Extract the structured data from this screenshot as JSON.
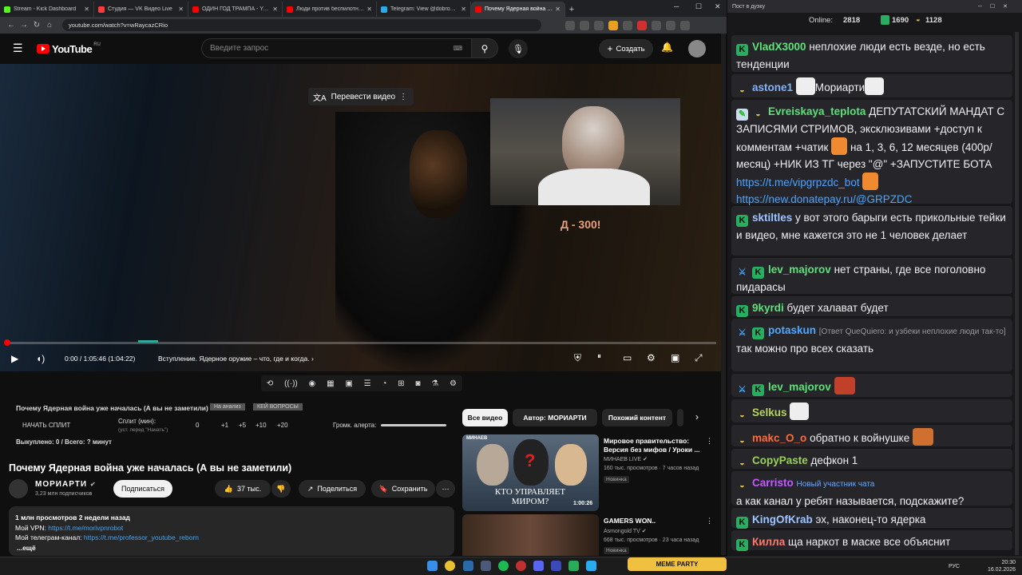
{
  "browser": {
    "tabs": [
      {
        "title": "Stream - Kick Dashboard",
        "color": "#53fc18"
      },
      {
        "title": "Студия — VK Видео Live",
        "color": "#ff3a3a"
      },
      {
        "title": "ОДИН ГОД ТРАМПА - YouTube",
        "color": "#ff0000"
      },
      {
        "title": "Люди против беспилотник: сек",
        "color": "#ff0000"
      },
      {
        "title": "Telegram: View @dobro_2ch",
        "color": "#2aabee"
      },
      {
        "title": "Почему Ядерная война уже н",
        "color": "#ff0000"
      }
    ],
    "url": "youtube.com/watch?v=wRaycazCRio"
  },
  "youtube": {
    "logo_text": "YouTube",
    "logo_region": "RU",
    "search_placeholder": "Введите запрос",
    "create_label": "Создать"
  },
  "video": {
    "translate_label": "Перевести видео",
    "overlay_caption": "Д - 300!",
    "time": "0:00 / 1:05:46 (1:04:22)",
    "chapter": "Вступление. Ядерное оружие – что, где и когда.",
    "progress": 0.0
  },
  "split_panel": {
    "title": "Почему Ядерная война уже началась (А вы не заметили)",
    "tag1": "На анализ",
    "tag2": "КЕЙ ВОПРОСЫ",
    "start_label": "НАЧАТЬ СПЛИТ",
    "split_min_label": "Сплит (мин):",
    "split_hint": "(уст. перед \"Начать\")",
    "value": "0",
    "inc": [
      "+1",
      "+5",
      "+10",
      "+20"
    ],
    "alert_label": "Громк. алерта:",
    "bought": "Выкуплено: 0 / Всего: ? минут"
  },
  "main": {
    "title": "Почему Ядерная война уже началась (А вы не заметили)",
    "channel": "МОРИАРТИ",
    "subs": "3,23 млн подписчиков",
    "subscribe": "Подписаться",
    "likes": "37 тыс.",
    "share": "Поделиться",
    "save": "Сохранить",
    "desc_line1": "1 млн просмотров  2 недели назад",
    "vpn_label": "Мой VPN: ",
    "vpn_link": "https://t.me/morivpnrobot",
    "tg_label": "Мой телеграм-канал: ",
    "tg_link": "https://t.me/professor_youtube_reborn",
    "more": "...ещё"
  },
  "chips": [
    "Все видео",
    "Автор: МОРИАРТИ",
    "Похожий контент"
  ],
  "recs": [
    {
      "title": "Мировое правительство: Версия без мифов / Уроки ...",
      "channel": "МИНАЕВ LIVE",
      "meta": "160 тыс. просмотров · 7 часов назад",
      "badge": "Новинка",
      "duration": "1:00:26",
      "thumb_text": "КТО УПРАВЛЯЕТ МИРОМ?",
      "thumb_brand": "МИНАЕВ"
    },
    {
      "title": "GAMERS WON..",
      "channel": "Asmongold TV",
      "meta": "668 тыс. просмотров · 23 часа назад",
      "badge": "Новинка",
      "duration": "",
      "thumb_text": "",
      "thumb_brand": ""
    }
  ],
  "chat": {
    "window_title": "Пост в дуэку",
    "online_label": "Online:",
    "online": "2818",
    "kick_count": "1690",
    "other_count": "1128",
    "messages": [
      {
        "user": "VladX3000",
        "user_color": "#5ee07a",
        "text": "неплохие люди есть везде, но есть тенденции"
      },
      {
        "user": "astone1",
        "user_color": "#7fb3ff",
        "text": "Мориарти"
      },
      {
        "user": "Evreiskaya_teplota",
        "user_color": "#5ee07a",
        "text": "ДЕПУТАТСКИЙ МАНДАТ С ЗАПИСЯМИ СТРИМОВ, эксклюзивами +доступ к комментам +чатик",
        "text2": "на 1, 3, 6, 12 месяцев (400р/месяц) +НИК ИЗ ТГ через \"@\" +ЗАПУСТИТЕ БОТА",
        "link1": "https://t.me/vipgrpzdc_bot",
        "link2": "https://new.donatepay.ru/@GRPZDC"
      },
      {
        "user": "sktiltles",
        "user_color": "#9ec5ff",
        "text": "у вот этого барыги есть прикольные тейки и видео, мне кажется это не 1 человек делает"
      },
      {
        "user": "lev_majorov",
        "user_color": "#5ee07a",
        "text": "нет страны, где все поголовно пидарасы"
      },
      {
        "user": "9kyrdi",
        "user_color": "#5ee07a",
        "text": "будет халават будет"
      },
      {
        "user": "potaskun",
        "user_color": "#4ea8ff",
        "reply": "[Ответ QueQuiero: и узбеки неплохие люди так-то]",
        "text": "так можно про всех сказать"
      },
      {
        "user": "lev_majorov",
        "user_color": "#5ee07a",
        "text": ""
      },
      {
        "user": "Selkus",
        "user_color": "#b8d25a",
        "text": ""
      },
      {
        "user": "makc_O_o",
        "user_color": "#ff6a3a",
        "text": "обратно к войнушке"
      },
      {
        "user": "CopyPaste",
        "user_color": "#9ad05a",
        "text": "дефкон 1"
      },
      {
        "user": "Carristo",
        "user_color": "#c05aff",
        "new": "Новый участник чата",
        "text": "а как канал у ребят называется, подскажите?"
      },
      {
        "user": "KingOfKrab",
        "user_color": "#9ec5ff",
        "text": "эх, наконец-то ядерка"
      },
      {
        "user": "Килла",
        "user_color": "#ff7a6a",
        "text": "ща наркот в маске все объяснит"
      }
    ]
  },
  "taskbar": {
    "meme": "MEME PARTY",
    "lang": "РУС",
    "time": "20:30",
    "date": "16.02.2026"
  }
}
